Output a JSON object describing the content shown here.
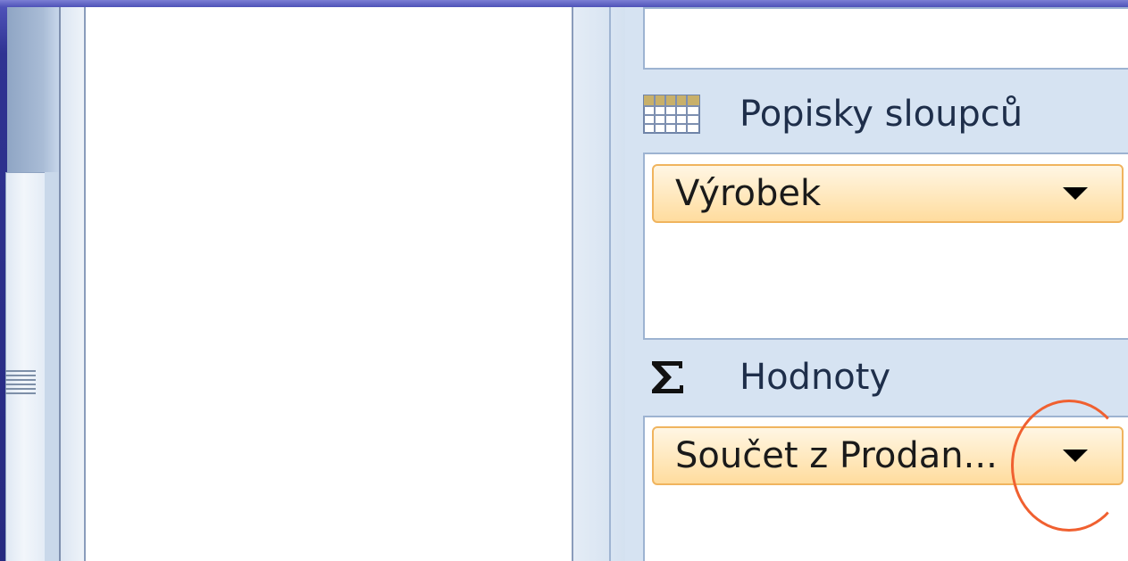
{
  "field_list": {
    "column_labels": {
      "heading": "Popisky sloupců",
      "icon": "column-labels-grid-icon",
      "fields": [
        {
          "label": "Výrobek"
        }
      ]
    },
    "values": {
      "heading": "Hodnoty",
      "icon": "sigma-icon",
      "fields": [
        {
          "label": "Součet z Prodan..."
        }
      ]
    }
  },
  "colors": {
    "chip_fill": "#ffe8bd",
    "chip_border": "#f0b45e",
    "pane_background": "#d6e3f2",
    "highlight_ring": "#f06030"
  }
}
